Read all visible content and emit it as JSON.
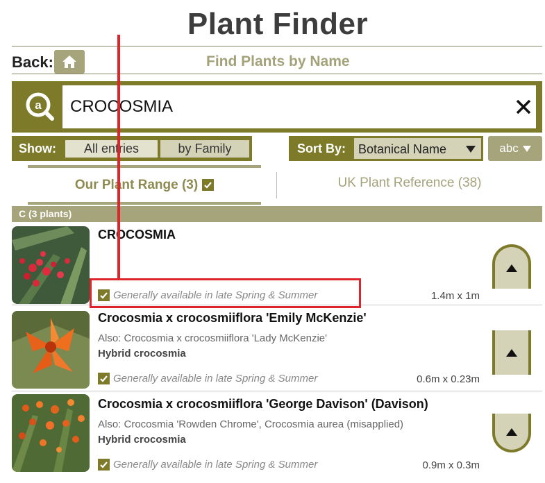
{
  "page": {
    "title": "Plant Finder"
  },
  "nav": {
    "back_label": "Back:",
    "section_title": "Find Plants by Name"
  },
  "search": {
    "value": "CROCOSMIA"
  },
  "filters": {
    "show_label": "Show:",
    "show_options": [
      "All entries",
      "by Family"
    ],
    "sort_label": "Sort By:",
    "sort_value": "Botanical Name",
    "order_label": "abc"
  },
  "tabs": {
    "our_range": "Our Plant Range (3)",
    "uk_reference": "UK Plant Reference (38)"
  },
  "group": {
    "header": "C  (3 plants)"
  },
  "plants": [
    {
      "name": "CROCOSMIA",
      "also": "",
      "family": "",
      "availability": "Generally available in late Spring & Summer",
      "size": "1.4m x 1m"
    },
    {
      "name": "Crocosmia x crocosmiiflora 'Emily McKenzie'",
      "also": "Also: Crocosmia x crocosmiiflora 'Lady McKenzie'",
      "family": "Hybrid crocosmia",
      "availability": "Generally available in late Spring & Summer",
      "size": "0.6m x 0.23m"
    },
    {
      "name": "Crocosmia x crocosmiiflora 'George Davison' (Davison)",
      "also": "Also: Crocosmia 'Rowden Chrome', Crocosmia aurea (misapplied)",
      "family": "Hybrid crocosmia",
      "availability": "Generally available in late Spring & Summer",
      "size": "0.9m x 0.3m"
    }
  ],
  "colors": {
    "olive": "#7d7a2a",
    "olive_light": "#a6a47a",
    "highlight_red": "#e0242e"
  }
}
